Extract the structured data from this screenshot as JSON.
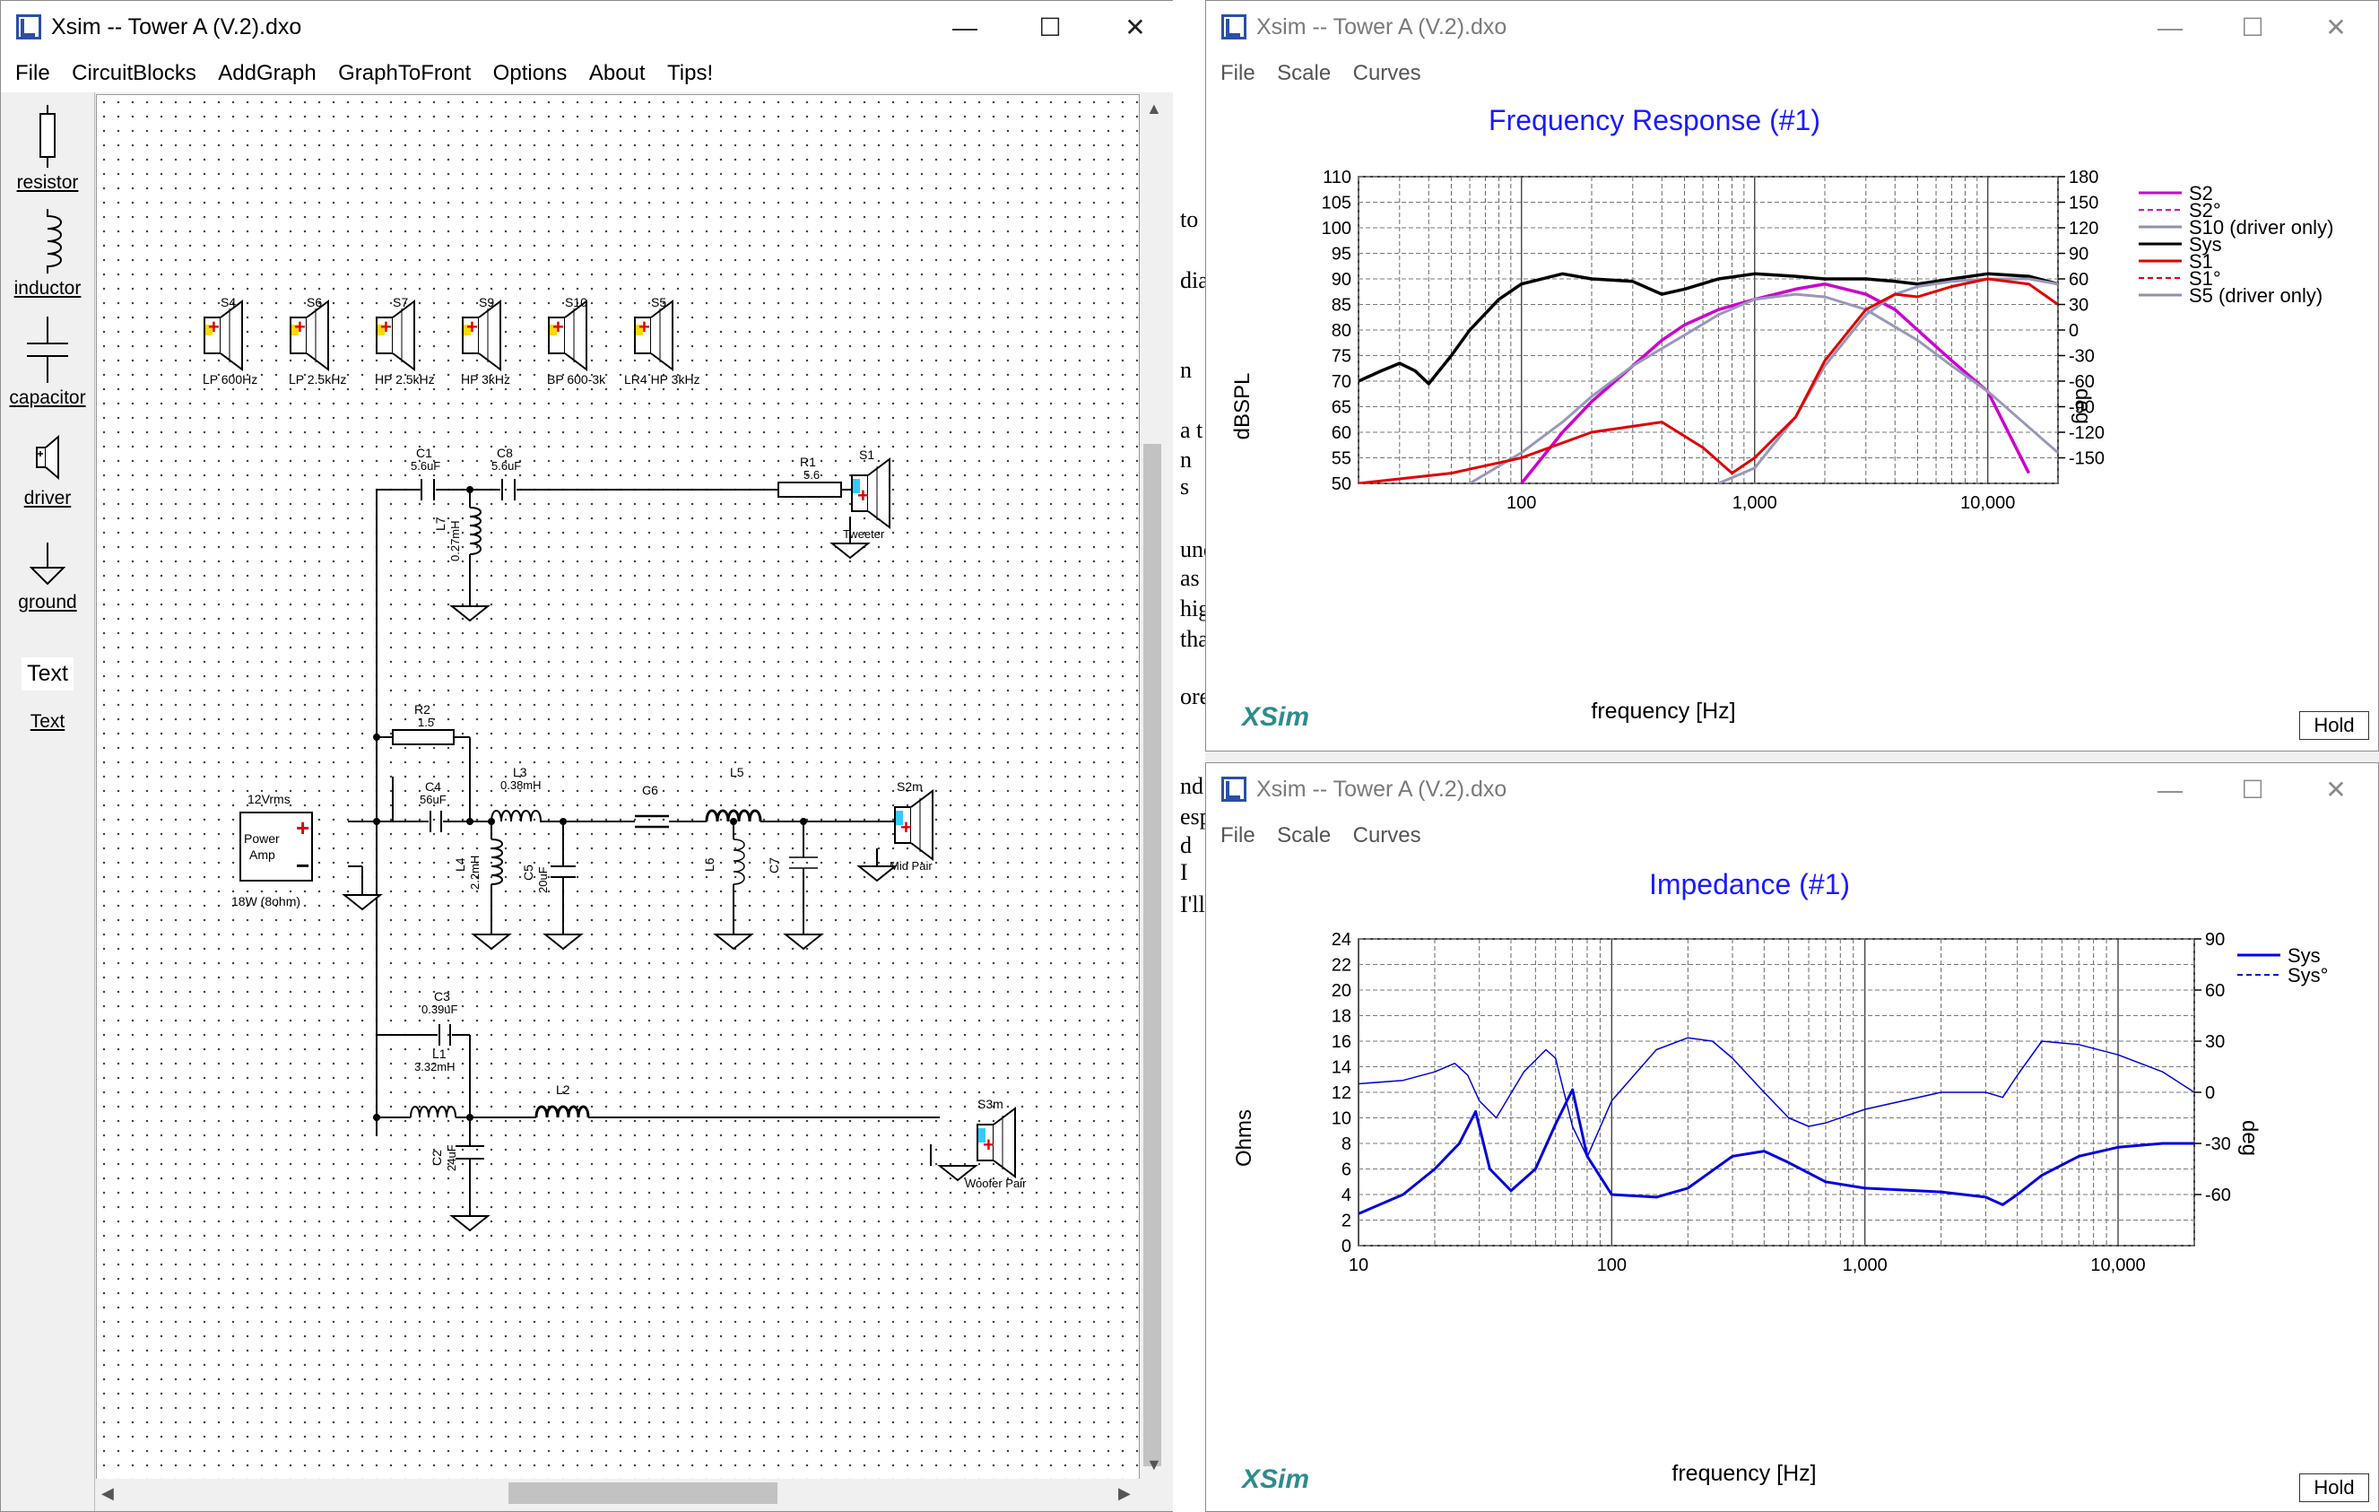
{
  "schematic_window": {
    "title": "Xsim -- Tower A (V.2).dxo",
    "menu": [
      "File",
      "CircuitBlocks",
      "AddGraph",
      "GraphToFront",
      "Options",
      "About",
      "Tips!"
    ],
    "palette": [
      {
        "label": "resistor",
        "icon": "resistor-icon"
      },
      {
        "label": "inductor",
        "icon": "inductor-icon"
      },
      {
        "label": "capacitor",
        "icon": "capacitor-icon"
      },
      {
        "label": "driver",
        "icon": "driver-icon"
      },
      {
        "label": "ground",
        "icon": "ground-icon"
      },
      {
        "label": "Text",
        "icon": "text-icon"
      },
      {
        "label": "Text",
        "icon": "text-link"
      }
    ],
    "drivers_row": [
      {
        "name": "S4",
        "label": "LP 600Hz"
      },
      {
        "name": "S6",
        "label": "LP 2.5kHz"
      },
      {
        "name": "S7",
        "label": "HP 2.5kHz"
      },
      {
        "name": "S9",
        "label": "HP 3kHz"
      },
      {
        "name": "S10",
        "label": "BP 600-3k"
      },
      {
        "name": "S5",
        "label": "LR4 HP 3kHz"
      }
    ],
    "components": {
      "c1": {
        "name": "C1",
        "value": "5.6uF"
      },
      "c8": {
        "name": "C8",
        "value": "5.6uF"
      },
      "l7": {
        "name": "L7",
        "value": "0.27mH"
      },
      "r1": {
        "name": "R1",
        "value": "5.6"
      },
      "s1": {
        "name": "S1",
        "label": "Tweeter"
      },
      "r2": {
        "name": "R2",
        "value": "1.5"
      },
      "source": {
        "name": "12Vrms",
        "line1": "Power",
        "line2": "Amp",
        "rating": "18W (8ohm)"
      },
      "c4": {
        "name": "C4",
        "value": "56uF"
      },
      "l3": {
        "name": "L3",
        "value": "0.38mH"
      },
      "l4": {
        "name": "L4",
        "value": "2.2mH"
      },
      "c5": {
        "name": "C5",
        "value": "20uF"
      },
      "c6": {
        "name": "C6"
      },
      "l5": {
        "name": "L5"
      },
      "l6": {
        "name": "L6"
      },
      "c7": {
        "name": "C7"
      },
      "s2": {
        "name": "S2m",
        "label": "Mid Pair"
      },
      "c3": {
        "name": "C3",
        "value": "0.39uF"
      },
      "l1": {
        "name": "L1",
        "value": "3.32mH"
      },
      "l2": {
        "name": "L2"
      },
      "c2": {
        "name": "C2",
        "value": "24uF"
      },
      "s3": {
        "name": "S3m",
        "label": "Woofer Pair"
      }
    }
  },
  "freq_window": {
    "title": "Xsim -- Tower A (V.2).dxo",
    "menu": [
      "File",
      "Scale",
      "Curves"
    ],
    "graph_title": "Frequency Response (#1)",
    "ylabel": "dBSPL",
    "y2label": "deg",
    "xlabel": "frequency [Hz]",
    "logo": "XSim",
    "hold": "Hold",
    "y_ticks": [
      "110",
      "105",
      "100",
      "95",
      "90",
      "85",
      "80",
      "75",
      "70",
      "65",
      "60",
      "55",
      "50"
    ],
    "y2_ticks": [
      "180",
      "150",
      "120",
      "90",
      "60",
      "30",
      "0",
      "-30",
      "-60",
      "-90",
      "-120",
      "-150"
    ],
    "x_ticks": [
      "100",
      "1,000",
      "10,000"
    ],
    "legend": [
      {
        "name": "S2",
        "color": "#cc00cc",
        "style": "solid"
      },
      {
        "name": "S2°",
        "color": "#cc00cc",
        "style": "dashed"
      },
      {
        "name": "S10 (driver only)",
        "color": "#9090b0",
        "style": "solid"
      },
      {
        "name": "Sys",
        "color": "#000000",
        "style": "solid"
      },
      {
        "name": "S1",
        "color": "#e00000",
        "style": "solid"
      },
      {
        "name": "S1°",
        "color": "#e00000",
        "style": "dashed"
      },
      {
        "name": "S5 (driver only)",
        "color": "#9090b0",
        "style": "solid"
      }
    ]
  },
  "imp_window": {
    "title": "Xsim -- Tower A (V.2).dxo",
    "menu": [
      "File",
      "Scale",
      "Curves"
    ],
    "graph_title": "Impedance (#1)",
    "ylabel": "Ohms",
    "y2label": "deg",
    "xlabel": "frequency [Hz]",
    "logo": "XSim",
    "hold": "Hold",
    "y_ticks": [
      "24",
      "22",
      "20",
      "18",
      "16",
      "14",
      "12",
      "10",
      "8",
      "6",
      "4",
      "2",
      "0"
    ],
    "y2_ticks": [
      "90",
      "60",
      "30",
      "0",
      "-30",
      "-60"
    ],
    "x_ticks": [
      "10",
      "100",
      "1,000",
      "10,000"
    ],
    "legend": [
      {
        "name": "Sys",
        "color": "#0000dd",
        "style": "solid"
      },
      {
        "name": "Sys°",
        "color": "#0000dd",
        "style": "dashed"
      }
    ]
  },
  "background_text": [
    "to",
    "dia",
    "n",
    "a t",
    "n s",
    "und",
    "as",
    "hig",
    "tha",
    "ore",
    "nd",
    "esp",
    "d I",
    "I'll"
  ],
  "chart_data": [
    {
      "type": "line",
      "title": "Frequency Response (#1)",
      "xlabel": "frequency [Hz]",
      "ylabel": "dBSPL",
      "y2label": "deg",
      "xscale": "log",
      "xlim": [
        20,
        20000
      ],
      "ylim": [
        50,
        110
      ],
      "y2lim": [
        -180,
        180
      ],
      "grid": true,
      "legend_position": "right",
      "series": [
        {
          "name": "Sys",
          "x": [
            20,
            25,
            30,
            35,
            40,
            50,
            60,
            80,
            100,
            150,
            200,
            300,
            400,
            500,
            700,
            1000,
            1500,
            2000,
            3000,
            4000,
            5000,
            7000,
            10000,
            15000,
            20000
          ],
          "y": [
            70,
            72,
            73.5,
            72,
            69.5,
            75,
            80,
            86,
            89,
            91,
            90,
            89.5,
            87,
            88,
            90,
            91,
            90.5,
            90,
            90,
            89.5,
            89,
            90,
            91,
            90.5,
            89
          ]
        },
        {
          "name": "S2",
          "x": [
            100,
            150,
            200,
            300,
            400,
            500,
            700,
            1000,
            1500,
            2000,
            3000,
            4000,
            5000,
            7000,
            10000,
            15000
          ],
          "y": [
            50,
            60,
            66,
            73,
            78,
            81,
            84,
            86,
            88,
            89,
            87,
            84,
            80,
            74,
            68,
            52
          ]
        },
        {
          "name": "S10 (driver only)",
          "x": [
            60,
            100,
            150,
            200,
            300,
            500,
            700,
            1000,
            1500,
            2000,
            3000,
            5000,
            7000,
            10000,
            20000
          ],
          "y": [
            50,
            56,
            62,
            67,
            73,
            79,
            83,
            86,
            87,
            86.5,
            84,
            78,
            73,
            68,
            56
          ]
        },
        {
          "name": "S5 (driver only)",
          "x": [
            700,
            1000,
            1500,
            2000,
            3000,
            4000,
            5000,
            7000,
            10000,
            15000,
            20000
          ],
          "y": [
            50,
            53,
            63,
            73,
            83,
            87,
            88.5,
            89.5,
            90,
            90,
            89
          ]
        },
        {
          "name": "S1",
          "x": [
            20,
            50,
            100,
            200,
            400,
            600,
            800,
            1000,
            1500,
            2000,
            3000,
            4000,
            5000,
            7000,
            10000,
            15000,
            20000
          ],
          "y": [
            50,
            52,
            55,
            60,
            62,
            57,
            52,
            55,
            63,
            74,
            84,
            87,
            86.5,
            88.5,
            90,
            89,
            85
          ]
        }
      ]
    },
    {
      "type": "line",
      "title": "Impedance (#1)",
      "xlabel": "frequency [Hz]",
      "ylabel": "Ohms",
      "y2label": "deg",
      "xscale": "log",
      "xlim": [
        10,
        20000
      ],
      "ylim": [
        0,
        24
      ],
      "y2lim": [
        -90,
        90
      ],
      "grid": true,
      "legend_position": "top-right",
      "series": [
        {
          "name": "Sys",
          "x": [
            10,
            15,
            20,
            25,
            29,
            33,
            40,
            50,
            60,
            70,
            80,
            100,
            150,
            200,
            300,
            400,
            500,
            700,
            1000,
            2000,
            3000,
            3500,
            4000,
            5000,
            7000,
            10000,
            15000,
            20000
          ],
          "y": [
            2.5,
            4,
            6,
            8,
            10.5,
            6,
            4.3,
            6,
            9.5,
            12.2,
            7,
            4,
            3.8,
            4.5,
            7,
            7.4,
            6.5,
            5,
            4.5,
            4.2,
            3.8,
            3.2,
            4,
            5.5,
            7,
            7.7,
            8,
            8
          ]
        },
        {
          "name": "Sys°",
          "x": [
            10,
            15,
            20,
            24,
            27,
            30,
            35,
            45,
            55,
            60,
            70,
            80,
            100,
            150,
            200,
            250,
            300,
            400,
            500,
            600,
            700,
            1000,
            2000,
            3000,
            3500,
            4000,
            5000,
            7000,
            10000,
            15000,
            20000
          ],
          "y": [
            5,
            7,
            12,
            17,
            10,
            -5,
            -15,
            12,
            25,
            20,
            -20,
            -38,
            -5,
            25,
            32,
            30,
            20,
            0,
            -15,
            -20,
            -18,
            -10,
            0,
            0,
            -3,
            10,
            30,
            28,
            22,
            12,
            0
          ]
        }
      ]
    }
  ]
}
